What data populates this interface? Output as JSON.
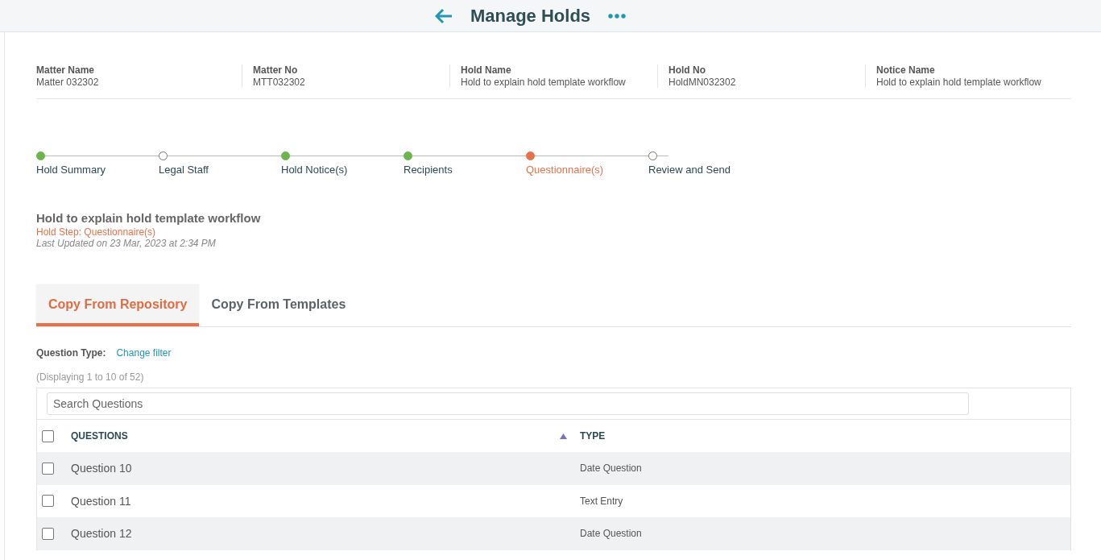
{
  "header": {
    "title": "Manage Holds"
  },
  "info": [
    {
      "label": "Matter Name",
      "value": "Matter 032302"
    },
    {
      "label": "Matter No",
      "value": "MTT032302"
    },
    {
      "label": "Hold Name",
      "value": "Hold to explain hold template workflow"
    },
    {
      "label": "Hold No",
      "value": "HoldMN032302"
    },
    {
      "label": "Notice Name",
      "value": "Hold to explain hold template workflow"
    }
  ],
  "steps": [
    {
      "label": "Hold Summary",
      "kind": "done"
    },
    {
      "label": "Legal Staff",
      "kind": "pending"
    },
    {
      "label": "Hold Notice(s)",
      "kind": "done"
    },
    {
      "label": "Recipients",
      "kind": "done"
    },
    {
      "label": "Questionnaire(s)",
      "kind": "current"
    },
    {
      "label": "Review and Send",
      "kind": "pending"
    }
  ],
  "hold": {
    "title": "Hold to explain hold template workflow",
    "step": "Hold Step: Questionnaire(s)",
    "updated": "Last Updated on 23 Mar, 2023 at 2:34 PM"
  },
  "tabs": [
    {
      "label": "Copy From Repository",
      "selected": true
    },
    {
      "label": "Copy From Templates",
      "selected": false
    }
  ],
  "filter": {
    "label": "Question Type:",
    "link": "Change filter"
  },
  "count": "(Displaying 1 to 10 of 52)",
  "search": {
    "placeholder": "Search Questions"
  },
  "table": {
    "select_all_checked": false,
    "columns": [
      {
        "label": "QUESTIONS",
        "sorted": true
      },
      {
        "label": "TYPE",
        "sorted": false
      }
    ],
    "rows": [
      {
        "question": "Question 10",
        "type": "Date Question",
        "checked": false
      },
      {
        "question": "Question 11",
        "type": "Text Entry",
        "checked": false
      },
      {
        "question": "Question 12",
        "type": "Date Question",
        "checked": false
      }
    ]
  }
}
